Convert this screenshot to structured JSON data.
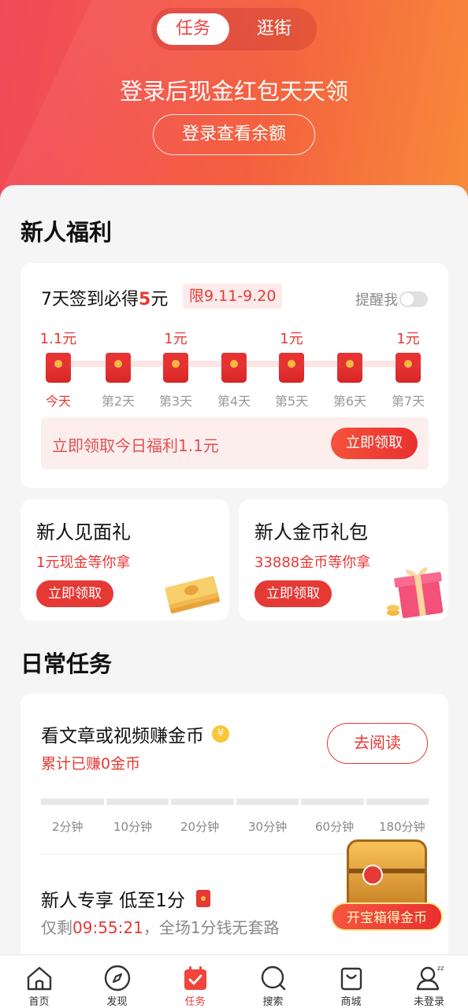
{
  "header": {
    "tabs": [
      {
        "label": "任务",
        "active": true
      },
      {
        "label": "逛街",
        "active": false
      }
    ],
    "title": "登录后现金红包天天领",
    "login_button": "登录查看余额"
  },
  "newbie": {
    "section_title": "新人福利",
    "signin": {
      "title_prefix": "7天签到必得",
      "title_highlight": "5",
      "title_suffix": "元",
      "limit_badge": "限9.11-9.20",
      "remind_label": "提醒我",
      "remind_on": false,
      "days": [
        {
          "reward": "1.1元",
          "label": "今天"
        },
        {
          "reward": "",
          "label": "第2天"
        },
        {
          "reward": "1元",
          "label": "第3天"
        },
        {
          "reward": "",
          "label": "第4天"
        },
        {
          "reward": "1元",
          "label": "第5天"
        },
        {
          "reward": "",
          "label": "第6天"
        },
        {
          "reward": "1元",
          "label": "第7天"
        }
      ],
      "claim_text": "立即领取今日福利1.1元",
      "claim_button": "立即领取"
    },
    "gifts": [
      {
        "title": "新人见面礼",
        "subtitle": "1元现金等你拿",
        "button": "立即领取",
        "icon": "cash-stack-icon"
      },
      {
        "title": "新人金币礼包",
        "subtitle": "33888金币等你拿",
        "button": "立即领取",
        "icon": "gift-box-icon"
      }
    ]
  },
  "daily": {
    "section_title": "日常任务",
    "read_task": {
      "title": "看文章或视频赚金币",
      "coin_icon": "coin-icon",
      "earned": "累计已赚0金币",
      "button": "去阅读",
      "progress_ticks": [
        "2分钟",
        "10分钟",
        "20分钟",
        "30分钟",
        "60分钟",
        "180分钟"
      ],
      "progress_fraction": 0
    },
    "promo": {
      "title": "新人专享 低至1分",
      "remaining_prefix": "仅剩",
      "countdown": "09:55:21",
      "remaining_suffix": "，全场1分钱无套路"
    }
  },
  "chest": {
    "label": "开宝箱得金币"
  },
  "nav": [
    {
      "label": "首页",
      "icon": "home-icon",
      "active": false
    },
    {
      "label": "发现",
      "icon": "compass-icon",
      "active": false
    },
    {
      "label": "任务",
      "icon": "task-calendar-icon",
      "active": true
    },
    {
      "label": "搜索",
      "icon": "search-icon",
      "active": false
    },
    {
      "label": "商城",
      "icon": "shopping-bag-icon",
      "active": false
    },
    {
      "label": "未登录",
      "icon": "user-icon",
      "active": false
    }
  ],
  "colors": {
    "brand": "#e53935",
    "hero_start": "#f2495a",
    "hero_end": "#f88a3a"
  }
}
